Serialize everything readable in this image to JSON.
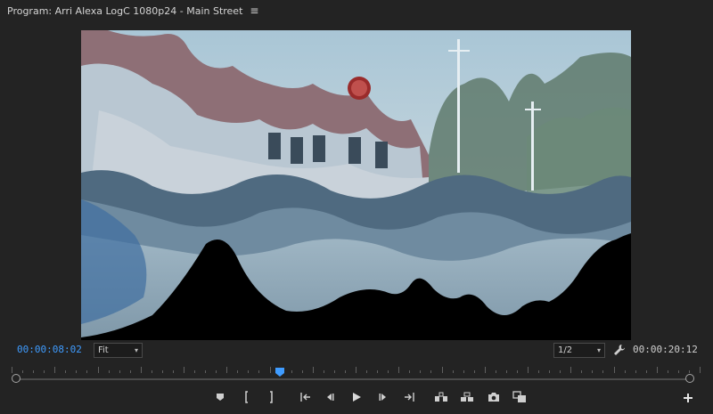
{
  "panel": {
    "title": "Program: Arri Alexa LogC 1080p24 - Main Street",
    "menu_glyph": "≡"
  },
  "timecode": {
    "current": "00:00:08:02",
    "duration": "00:00:20:12"
  },
  "zoom_select": {
    "value": "Fit"
  },
  "resolution_select": {
    "value": "1/2"
  },
  "playback_position": 0.39,
  "icons": {
    "menu": "hamburger-menu-icon",
    "settings": "wrench-icon",
    "add": "plus-icon"
  },
  "transport_buttons": [
    "add-marker",
    "mark-in",
    "mark-out",
    "go-to-in",
    "step-back",
    "play",
    "step-forward",
    "go-to-out",
    "lift",
    "extract",
    "export-frame",
    "comparison-view"
  ],
  "colors": {
    "accent": "#3f9cff",
    "background": "#232323"
  }
}
